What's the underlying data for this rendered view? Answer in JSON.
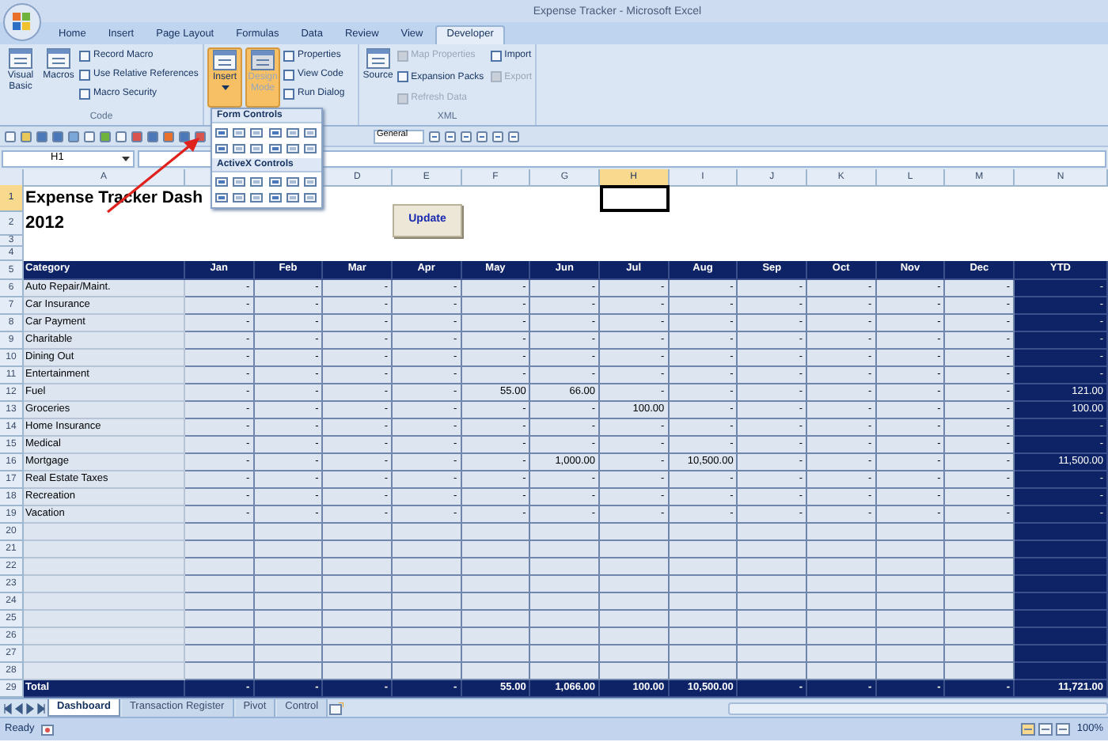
{
  "window": {
    "title": "Expense Tracker - Microsoft Excel"
  },
  "ribbon_tabs": [
    {
      "label": "Home",
      "selected": false
    },
    {
      "label": "Insert",
      "selected": false
    },
    {
      "label": "Page Layout",
      "selected": false
    },
    {
      "label": "Formulas",
      "selected": false
    },
    {
      "label": "Data",
      "selected": false
    },
    {
      "label": "Review",
      "selected": false
    },
    {
      "label": "View",
      "selected": false
    },
    {
      "label": "Developer",
      "selected": true
    }
  ],
  "ribbon_groups": [
    {
      "label": "Code",
      "large_buttons": [
        {
          "label": "Visual Basic",
          "pressed": false,
          "disabled": false,
          "dropdown": false
        },
        {
          "label": "Macros",
          "pressed": false,
          "disabled": false,
          "dropdown": false
        }
      ],
      "small_buttons": [
        {
          "label": "Record Macro",
          "disabled": false
        },
        {
          "label": "Use Relative References",
          "disabled": false
        },
        {
          "label": "Macro Security",
          "disabled": false
        }
      ]
    },
    {
      "large_buttons": [
        {
          "label": "Insert",
          "pressed": true,
          "disabled": false,
          "dropdown": true
        },
        {
          "label": "Design Mode",
          "pressed": true,
          "disabled": true,
          "dropdown": false
        }
      ],
      "small_buttons": [
        {
          "label": "Properties",
          "disabled": false
        },
        {
          "label": "View Code",
          "disabled": false
        },
        {
          "label": "Run Dialog",
          "disabled": false
        }
      ]
    },
    {
      "label": "XML",
      "large_buttons": [
        {
          "label": "Source",
          "pressed": false,
          "disabled": false,
          "dropdown": false
        }
      ],
      "small_buttons": [
        {
          "label": "Map Properties",
          "disabled": true
        },
        {
          "label": "Expansion Packs",
          "disabled": false
        },
        {
          "label": "Refresh Data",
          "disabled": true
        },
        {
          "label": "Import",
          "disabled": false
        },
        {
          "label": "Export",
          "disabled": true
        }
      ]
    }
  ],
  "insert_menu": {
    "sections": [
      {
        "title": "Form Controls"
      },
      {
        "title": "ActiveX Controls"
      }
    ]
  },
  "toolbar": {
    "number_format": "General"
  },
  "formula_bar": {
    "name_box": "H1"
  },
  "columns": [
    {
      "letter": "A",
      "selected": false
    },
    {
      "selected": false
    },
    {
      "selected": false
    },
    {
      "letter": "D",
      "selected": false
    },
    {
      "letter": "E",
      "selected": false
    },
    {
      "letter": "F",
      "selected": false
    },
    {
      "letter": "G",
      "selected": false
    },
    {
      "letter": "H",
      "selected": true
    },
    {
      "letter": "I",
      "selected": false
    },
    {
      "letter": "J",
      "selected": false
    },
    {
      "letter": "K",
      "selected": false
    },
    {
      "letter": "L",
      "selected": false
    },
    {
      "letter": "M",
      "selected": false
    },
    {
      "letter": "N",
      "selected": false
    }
  ],
  "rows": [
    {
      "number": "1",
      "kind": "title",
      "selected": true,
      "text": "Expense Tracker Dash"
    },
    {
      "number": "2",
      "kind": "subtitle",
      "selected": false,
      "text": "2012"
    },
    {
      "number": "3",
      "kind": "spacer",
      "selected": false
    },
    {
      "number": "4",
      "kind": "blank",
      "selected": false
    },
    {
      "number": "5",
      "kind": "header",
      "selected": false,
      "category": "Category",
      "cells": [
        "Jan",
        "Feb",
        "Mar",
        "Apr",
        "May",
        "Jun",
        "Jul",
        "Aug",
        "Sep",
        "Oct",
        "Nov",
        "Dec",
        "YTD"
      ]
    },
    {
      "number": "6",
      "kind": "data",
      "selected": false,
      "category": "Auto Repair/Maint.",
      "cells": [
        "-",
        "-",
        "-",
        "-",
        "-",
        "-",
        "-",
        "-",
        "-",
        "-",
        "-",
        "-",
        "-"
      ]
    },
    {
      "number": "7",
      "kind": "data",
      "selected": false,
      "category": "Car Insurance",
      "cells": [
        "-",
        "-",
        "-",
        "-",
        "-",
        "-",
        "-",
        "-",
        "-",
        "-",
        "-",
        "-",
        "-"
      ]
    },
    {
      "number": "8",
      "kind": "data",
      "selected": false,
      "category": "Car Payment",
      "cells": [
        "-",
        "-",
        "-",
        "-",
        "-",
        "-",
        "-",
        "-",
        "-",
        "-",
        "-",
        "-",
        "-"
      ]
    },
    {
      "number": "9",
      "kind": "data",
      "selected": false,
      "category": "Charitable",
      "cells": [
        "-",
        "-",
        "-",
        "-",
        "-",
        "-",
        "-",
        "-",
        "-",
        "-",
        "-",
        "-",
        "-"
      ]
    },
    {
      "number": "10",
      "kind": "data",
      "selected": false,
      "category": "Dining Out",
      "cells": [
        "-",
        "-",
        "-",
        "-",
        "-",
        "-",
        "-",
        "-",
        "-",
        "-",
        "-",
        "-",
        "-"
      ]
    },
    {
      "number": "11",
      "kind": "data",
      "selected": false,
      "category": "Entertainment",
      "cells": [
        "-",
        "-",
        "-",
        "-",
        "-",
        "-",
        "-",
        "-",
        "-",
        "-",
        "-",
        "-",
        "-"
      ]
    },
    {
      "number": "12",
      "kind": "data",
      "selected": false,
      "category": "Fuel",
      "cells": [
        "-",
        "-",
        "-",
        "-",
        "55.00",
        "66.00",
        "-",
        "-",
        "-",
        "-",
        "-",
        "-",
        "121.00"
      ]
    },
    {
      "number": "13",
      "kind": "data",
      "selected": false,
      "category": "Groceries",
      "cells": [
        "-",
        "-",
        "-",
        "-",
        "-",
        "-",
        "100.00",
        "-",
        "-",
        "-",
        "-",
        "-",
        "100.00"
      ]
    },
    {
      "number": "14",
      "kind": "data",
      "selected": false,
      "category": "Home Insurance",
      "cells": [
        "-",
        "-",
        "-",
        "-",
        "-",
        "-",
        "-",
        "-",
        "-",
        "-",
        "-",
        "-",
        "-"
      ]
    },
    {
      "number": "15",
      "kind": "data",
      "selected": false,
      "category": "Medical",
      "cells": [
        "-",
        "-",
        "-",
        "-",
        "-",
        "-",
        "-",
        "-",
        "-",
        "-",
        "-",
        "-",
        "-"
      ]
    },
    {
      "number": "16",
      "kind": "data",
      "selected": false,
      "category": "Mortgage",
      "cells": [
        "-",
        "-",
        "-",
        "-",
        "-",
        "1,000.00",
        "-",
        "10,500.00",
        "-",
        "-",
        "-",
        "-",
        "11,500.00"
      ]
    },
    {
      "number": "17",
      "kind": "data",
      "selected": false,
      "category": "Real Estate Taxes",
      "cells": [
        "-",
        "-",
        "-",
        "-",
        "-",
        "-",
        "-",
        "-",
        "-",
        "-",
        "-",
        "-",
        "-"
      ]
    },
    {
      "number": "18",
      "kind": "data",
      "selected": false,
      "category": "Recreation",
      "cells": [
        "-",
        "-",
        "-",
        "-",
        "-",
        "-",
        "-",
        "-",
        "-",
        "-",
        "-",
        "-",
        "-"
      ]
    },
    {
      "number": "19",
      "kind": "data",
      "selected": false,
      "category": "Vacation",
      "cells": [
        "-",
        "-",
        "-",
        "-",
        "-",
        "-",
        "-",
        "-",
        "-",
        "-",
        "-",
        "-",
        "-"
      ]
    },
    {
      "number": "20",
      "kind": "data",
      "selected": false
    },
    {
      "number": "21",
      "kind": "data",
      "selected": false
    },
    {
      "number": "22",
      "kind": "data",
      "selected": false
    },
    {
      "number": "23",
      "kind": "data",
      "selected": false
    },
    {
      "number": "24",
      "kind": "data",
      "selected": false
    },
    {
      "number": "25",
      "kind": "data",
      "selected": false
    },
    {
      "number": "26",
      "kind": "data",
      "selected": false
    },
    {
      "number": "27",
      "kind": "data",
      "selected": false
    },
    {
      "number": "28",
      "kind": "data",
      "selected": false
    },
    {
      "number": "29",
      "kind": "total",
      "selected": false,
      "category": "Total",
      "cells": [
        "-",
        "-",
        "-",
        "-",
        "55.00",
        "1,066.00",
        "100.00",
        "10,500.00",
        "-",
        "-",
        "-",
        "-",
        "11,721.00"
      ]
    }
  ],
  "update_button": {
    "label": "Update"
  },
  "sheet_tabs": [
    {
      "label": "Dashboard",
      "selected": true
    },
    {
      "label": "Transaction Register",
      "selected": false
    },
    {
      "label": "Pivot",
      "selected": false
    },
    {
      "label": "Control",
      "selected": false
    }
  ],
  "status_bar": {
    "status": "Ready",
    "zoom": "100%"
  }
}
